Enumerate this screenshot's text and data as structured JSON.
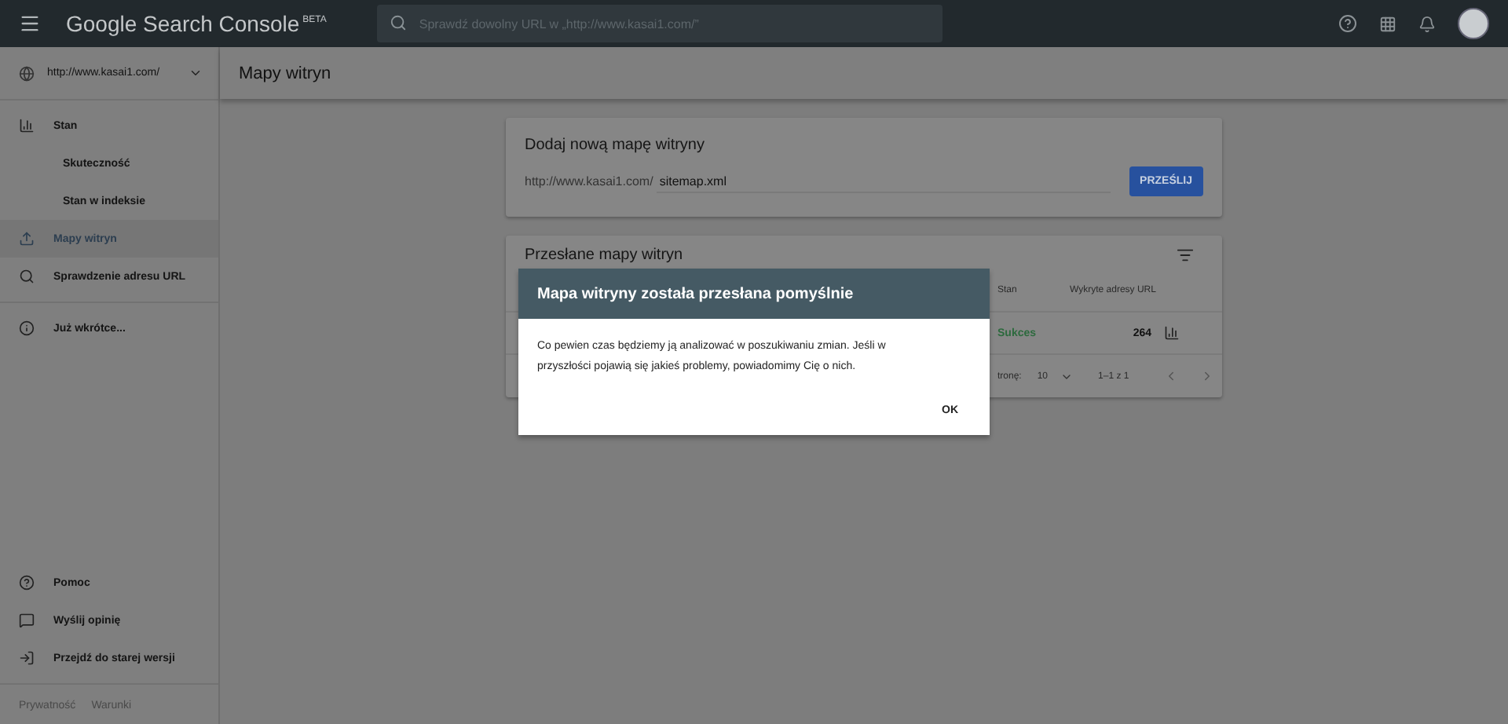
{
  "header": {
    "app_name": "Google Search Console",
    "badge": "BETA",
    "search": {
      "placeholder": "Sprawdź dowolny URL w „http://www.kasai1.com/”"
    }
  },
  "sidebar": {
    "property": "http://www.kasai1.com/",
    "items": [
      {
        "label": "Stan",
        "selected": false,
        "children": [
          {
            "label": "Skuteczność",
            "selected": false
          },
          {
            "label": "Stan w indeksie",
            "selected": false
          }
        ]
      },
      {
        "label": "Mapy witryn",
        "selected": true
      },
      {
        "label": "Sprawdzenie adresu URL",
        "selected": false
      },
      {
        "label": "Już wkrótce...",
        "selected": false
      }
    ],
    "bottom_items": [
      {
        "label": "Pomoc"
      },
      {
        "label": "Wyślij opinię"
      },
      {
        "label": "Przejdź do starej wersji"
      }
    ],
    "footer_links": [
      "Prywatność",
      "Warunki"
    ]
  },
  "page_title": "Mapy witryn",
  "add_card": {
    "title": "Dodaj nową mapę witryny",
    "prefix": "http://www.kasai1.com/",
    "value": "sitemap.xml",
    "button": "PRZEŚLIJ"
  },
  "list_card": {
    "title": "Przesłane mapy witryn",
    "columns": [
      "Stan",
      "Wykryte adresy URL"
    ],
    "rows": [
      {
        "status": "Sukces",
        "urls": "264"
      }
    ],
    "footer": {
      "rows_label": "tronę:",
      "rows_value": "10",
      "range": "1–1 z 1"
    }
  },
  "dialog": {
    "title": "Mapa witryny została przesłana pomyślnie",
    "body": "Co pewien czas będziemy ją analizować w poszukiwaniu zmian. Jeśli w przyszłości pojawią się jakieś problemy, powiadomimy Cię o nich.",
    "button": "OK"
  }
}
